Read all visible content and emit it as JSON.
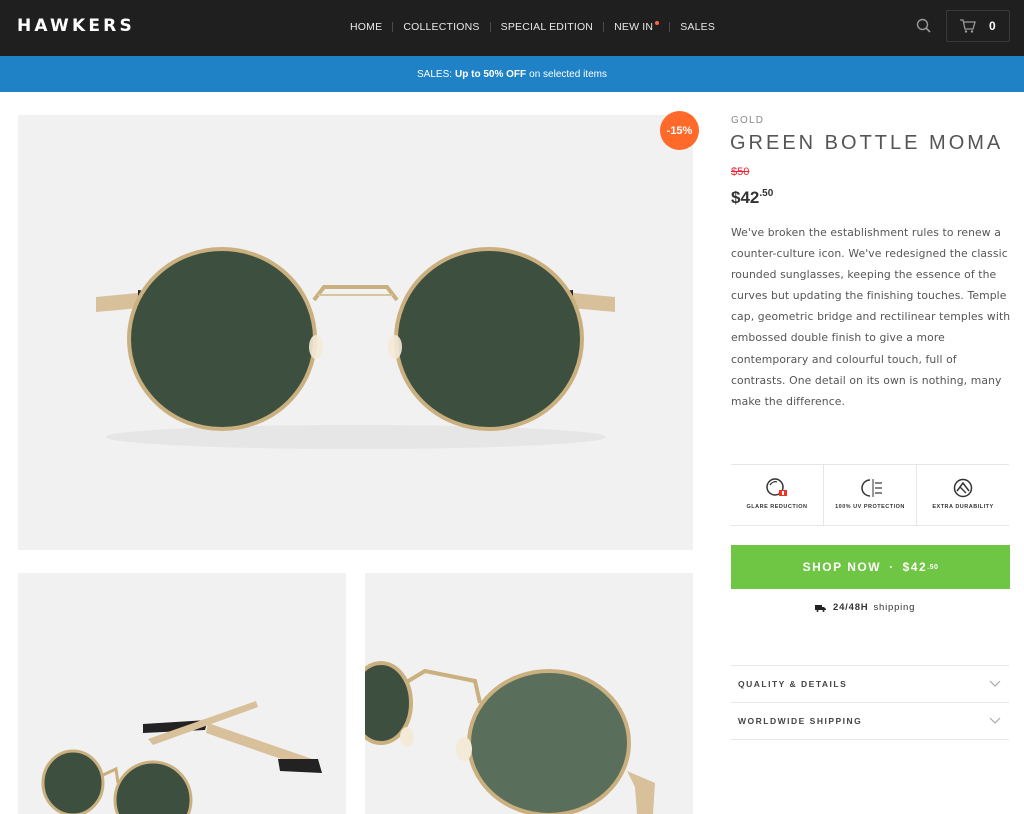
{
  "header": {
    "logo": "HAWKERS",
    "nav": [
      "HOME",
      "COLLECTIONS",
      "SPECIAL EDITION",
      "NEW IN",
      "SALES"
    ],
    "cart_count": "0"
  },
  "promo": {
    "prefix": "SALES:",
    "highlight": "Up to 50% OFF",
    "suffix": "on selected items"
  },
  "gallery": {
    "discount_badge": "-15%"
  },
  "product": {
    "brand_label": "GOLD",
    "title": "GREEN BOTTLE MOMA",
    "old_price": "$50",
    "price_main": "$42",
    "price_cents": ".50",
    "description": "We've broken the establishment rules to renew a counter-culture icon. We've redesigned the classic rounded sunglasses, keeping the essence of the curves but updating the finishing touches. Temple cap, geometric bridge and rectilinear temples with embossed double finish to give a more contemporary and colourful touch, full of contrasts. One detail on its own is nothing, many make the difference.",
    "features": [
      {
        "label": "GLARE REDUCTION",
        "icon": "glare-reduction-icon"
      },
      {
        "label": "100% UV PROTECTION",
        "icon": "uv-protection-icon"
      },
      {
        "label": "EXTRA DURABILITY",
        "icon": "extra-durability-icon"
      }
    ],
    "shop_button": {
      "label": "SHOP NOW",
      "separator": "·",
      "price_main": "$42",
      "price_cents": ".50"
    },
    "shipping": {
      "bold": "24/48H",
      "text": "shipping"
    },
    "accordion": [
      "QUALITY & DETAILS",
      "WORLDWIDE SHIPPING"
    ]
  },
  "colors": {
    "header_bg": "#1f1f1f",
    "promo_bg": "#1f82c7",
    "badge": "#ff6a2b",
    "shop_button": "#6fc544",
    "old_price": "#e22233"
  }
}
